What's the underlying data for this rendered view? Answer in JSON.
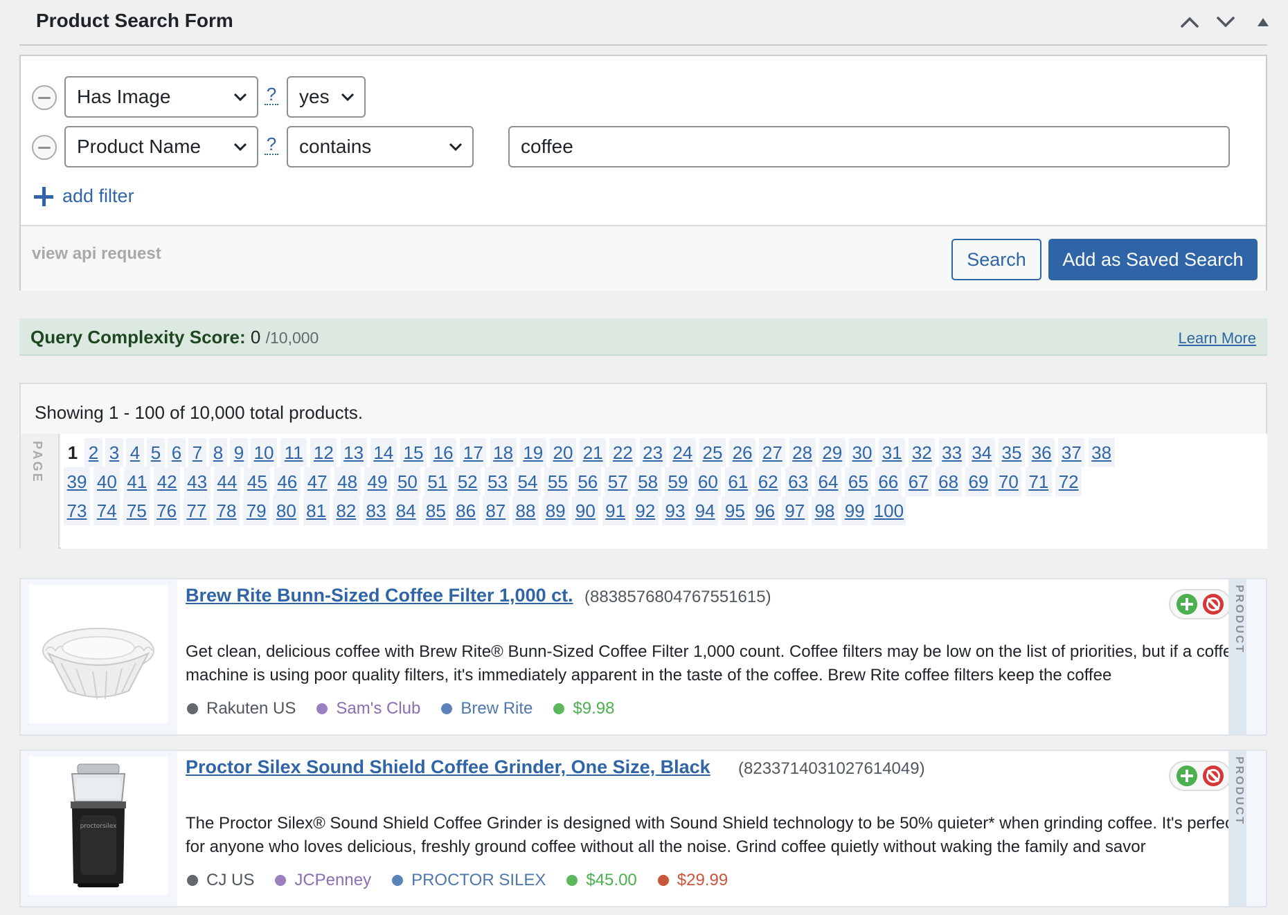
{
  "header": {
    "title": "Product Search Form"
  },
  "filters": [
    {
      "field": "Has Image",
      "help": "?",
      "operator": "yes",
      "value": null
    },
    {
      "field": "Product Name",
      "help": "?",
      "operator": "contains",
      "value": "coffee"
    }
  ],
  "add_filter_label": "add filter",
  "footer": {
    "view_api_label": "view api request",
    "search_label": "Search",
    "save_label": "Add as Saved Search"
  },
  "query_complexity": {
    "label": "Query Complexity Score:",
    "score": "0",
    "max": "/10,000",
    "learn_more": "Learn More"
  },
  "pagination": {
    "showing": "Showing 1 - 100 of 10,000 total products.",
    "side_label": "PAGE",
    "current_page": 1,
    "total_pages": 100
  },
  "products": [
    {
      "title": "Brew Rite Bunn-Sized Coffee Filter 1,000 ct.",
      "id": "(8838576804767551615)",
      "description": "Get clean, delicious coffee with Brew Rite® Bunn-Sized Coffee Filter 1,000 count. Coffee filters may be low on the list of priorities, but if a coffee machine is using poor quality filters, it's immediately apparent in the taste of the coffee. Brew Rite coffee filters keep the coffee",
      "side_label": "PRODUCT",
      "tags": [
        {
          "label": "Rakuten US",
          "color": "#646970",
          "text_color": "#50575e"
        },
        {
          "label": "Sam's Club",
          "color": "#9b7fc1",
          "text_color": "#8a6db3"
        },
        {
          "label": "Brew Rite",
          "color": "#5b83b8",
          "text_color": "#4f77ad"
        },
        {
          "label": "$9.98",
          "color": "#5cb85c",
          "text_color": "#4caf50"
        }
      ],
      "image": "coffee-filter"
    },
    {
      "title": "Proctor Silex Sound Shield Coffee Grinder, One Size, Black",
      "id": "(8233714031027614049)",
      "description": "The Proctor Silex® Sound Shield Coffee Grinder is designed with Sound Shield technology to be 50% quieter* when grinding coffee. It's perfect for anyone who loves delicious, freshly ground coffee without all the noise. Grind coffee quietly without waking the family and savor",
      "side_label": "PRODUCT",
      "tags": [
        {
          "label": "CJ US",
          "color": "#646970",
          "text_color": "#50575e"
        },
        {
          "label": "JCPenney",
          "color": "#9b7fc1",
          "text_color": "#8a6db3"
        },
        {
          "label": "PROCTOR SILEX",
          "color": "#5b83b8",
          "text_color": "#4f77ad"
        },
        {
          "label": "$45.00",
          "color": "#5cb85c",
          "text_color": "#4caf50"
        },
        {
          "label": "$29.99",
          "color": "#c9553a",
          "text_color": "#c9553a"
        }
      ],
      "image": "coffee-grinder"
    }
  ],
  "icons": {
    "collapse_up": "chevron-up-icon",
    "collapse_down": "chevron-down-icon",
    "toggle": "triangle-up-icon",
    "remove": "minus-circle-icon",
    "add": "plus-icon",
    "add_product": "plus-circle-icon",
    "block_product": "block-icon"
  },
  "colors": {
    "accent": "#2f65a6",
    "complexity_bg": "#dbe9e1"
  }
}
